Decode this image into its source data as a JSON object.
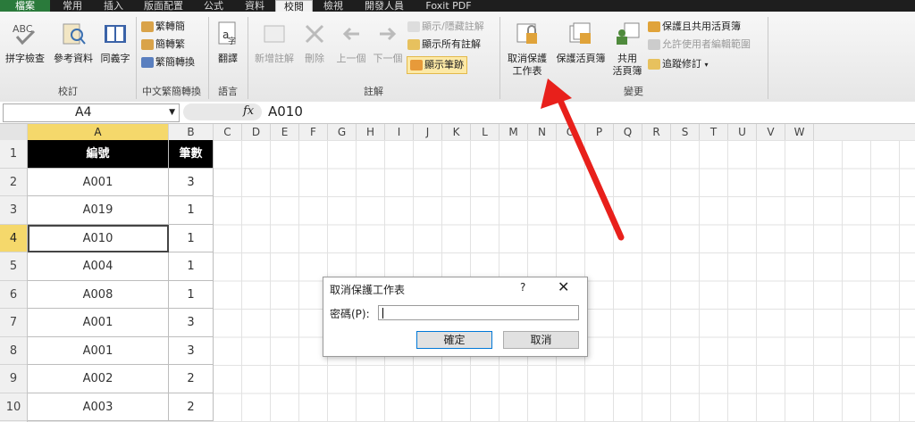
{
  "tabs": [
    "檔案",
    "常用",
    "插入",
    "版面配置",
    "公式",
    "資料",
    "校閱",
    "檢視",
    "開發人員",
    "Foxit PDF"
  ],
  "ribbon": {
    "proofing": {
      "spell": "拼字檢查",
      "research": "參考資料",
      "thesaurus": "同義字",
      "label": "校訂"
    },
    "chinese": {
      "t2s": "繁轉簡",
      "s2t": "簡轉繁",
      "convert": "繁簡轉換",
      "label": "中文繁簡轉換"
    },
    "language": {
      "translate": "翻譯",
      "label": "語言"
    },
    "comments": {
      "new": "新增註解",
      "delete": "刪除",
      "prev": "上一個",
      "next": "下一個",
      "showhide": "顯示/隱藏註解",
      "showall": "顯示所有註解",
      "ink": "顯示筆跡",
      "label": "註解"
    },
    "changes": {
      "unprotect_l1": "取消保護",
      "unprotect_l2": "工作表",
      "protect_wb": "保護活頁簿",
      "share_l1": "共用",
      "share_l2": "活頁簿",
      "protect_share": "保護且共用活頁簿",
      "allow_edit": "允許使用者編輯範圍",
      "track": "追蹤修訂",
      "label": "變更"
    }
  },
  "namebox": "A4",
  "formula_value": "A010",
  "fx_label": "fx",
  "columns": [
    "A",
    "B",
    "C",
    "D",
    "E",
    "F",
    "G",
    "H",
    "I",
    "J",
    "K",
    "L",
    "M",
    "N",
    "O",
    "P",
    "Q",
    "R",
    "S",
    "T",
    "U",
    "V",
    "W"
  ],
  "rows": [
    "1",
    "2",
    "3",
    "4",
    "5",
    "6",
    "7",
    "8",
    "9",
    "10"
  ],
  "table": {
    "headers": [
      "編號",
      "筆數"
    ],
    "rows": [
      [
        "A001",
        "3"
      ],
      [
        "A019",
        "1"
      ],
      [
        "A010",
        "1"
      ],
      [
        "A004",
        "1"
      ],
      [
        "A008",
        "1"
      ],
      [
        "A001",
        "3"
      ],
      [
        "A001",
        "3"
      ],
      [
        "A002",
        "2"
      ],
      [
        "A003",
        "2"
      ]
    ]
  },
  "dialog": {
    "title": "取消保護工作表",
    "help": "?",
    "close": "✕",
    "password_label": "密碼(P):",
    "password_value": "",
    "ok": "確定",
    "cancel": "取消"
  },
  "colors": {
    "file_tab": "#2a7a3b",
    "selected_header": "#f5d86b",
    "arrow": "#e8201b"
  }
}
